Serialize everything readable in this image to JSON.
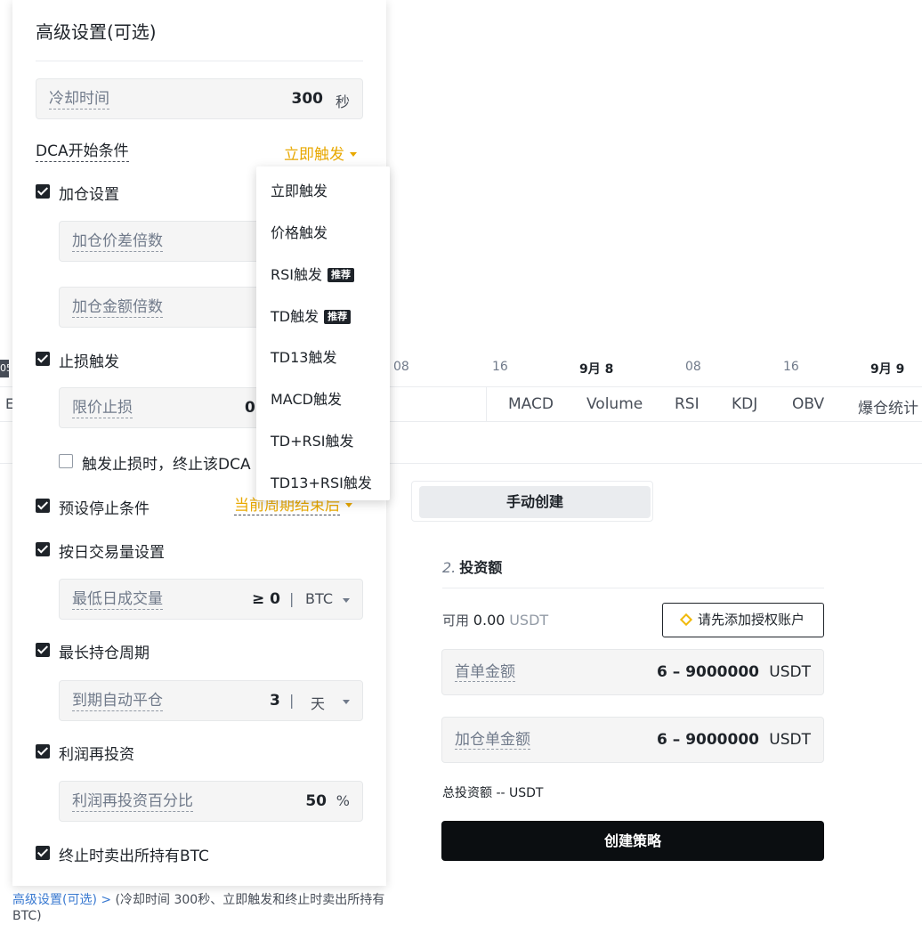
{
  "chart_axis": {
    "left_tag": "05",
    "ticks": [
      {
        "label": "08",
        "bold": false
      },
      {
        "label": "16",
        "bold": false
      },
      {
        "label": "9月 8",
        "bold": true
      },
      {
        "label": "08",
        "bold": false
      },
      {
        "label": "16",
        "bold": false
      },
      {
        "label": "9月 9",
        "bold": true
      }
    ]
  },
  "indicators": {
    "left_letter": "E",
    "items": [
      "MACD",
      "Volume",
      "RSI",
      "KDJ",
      "OBV",
      "爆仓统计"
    ]
  },
  "creation": {
    "manual_label": "手动创建"
  },
  "investment": {
    "step_number": "2.",
    "title": "投资额",
    "available_label": "可用",
    "available_value": "0.00",
    "available_unit": "USDT",
    "auth_button": "请先添加授权账户",
    "first_order_label": "首单金额",
    "first_order_range": "6 – 9000000",
    "first_order_unit": "USDT",
    "add_order_label": "加仓单金额",
    "add_order_range": "6 – 9000000",
    "add_order_unit": "USDT",
    "total_text": "总投资额 -- USDT",
    "create_button": "创建策略"
  },
  "footer": {
    "link": "高级设置(可选) >",
    "desc": " (冷却时间 300秒、立即触发和终止时卖出所持有BTC)"
  },
  "advanced": {
    "title": "高级设置(可选)",
    "cooldown_label": "冷却时间",
    "cooldown_value": "300",
    "cooldown_unit": "秒",
    "dca_start_label": "DCA开始条件",
    "dca_start_value": "立即触发",
    "add_position_label": "加仓设置",
    "add_position_checked": true,
    "price_diff_label": "加仓价差倍数",
    "amount_mult_label": "加仓金额倍数",
    "stop_loss_label": "止损触发",
    "stop_loss_checked": true,
    "limit_stop_label": "限价止损",
    "limit_stop_value": "0.",
    "terminate_label": "触发止损时，终止该DCA",
    "terminate_checked": false,
    "preset_stop_label": "预设停止条件",
    "preset_stop_checked": true,
    "preset_stop_value": "当前周期结束后",
    "daily_volume_label": "按日交易量设置",
    "daily_volume_checked": true,
    "min_volume_label": "最低日成交量",
    "min_volume_value": "≥ 0",
    "min_volume_unit": "BTC",
    "max_hold_label": "最长持仓周期",
    "max_hold_checked": true,
    "auto_close_label": "到期自动平仓",
    "auto_close_value": "3",
    "auto_close_unit": "天",
    "reinvest_label": "利润再投资",
    "reinvest_checked": true,
    "reinvest_pct_label": "利润再投资百分比",
    "reinvest_pct_value": "50",
    "reinvest_pct_unit": "%",
    "sell_on_stop_label": "终止时卖出所持有BTC",
    "sell_on_stop_checked": true
  },
  "dropdown": {
    "tag_label": "推荐",
    "options": [
      {
        "label": "立即触发",
        "tag": false
      },
      {
        "label": "价格触发",
        "tag": false
      },
      {
        "label": "RSI触发",
        "tag": true
      },
      {
        "label": "TD触发",
        "tag": true
      },
      {
        "label": "TD13触发",
        "tag": false
      },
      {
        "label": "MACD触发",
        "tag": false
      },
      {
        "label": "TD+RSI触发",
        "tag": false
      },
      {
        "label": "TD13+RSI触发",
        "tag": false
      }
    ]
  },
  "colors": {
    "accent_gold": "#e8a800",
    "primary_dark": "#0b0e11",
    "link_blue": "#3a7ad1"
  }
}
